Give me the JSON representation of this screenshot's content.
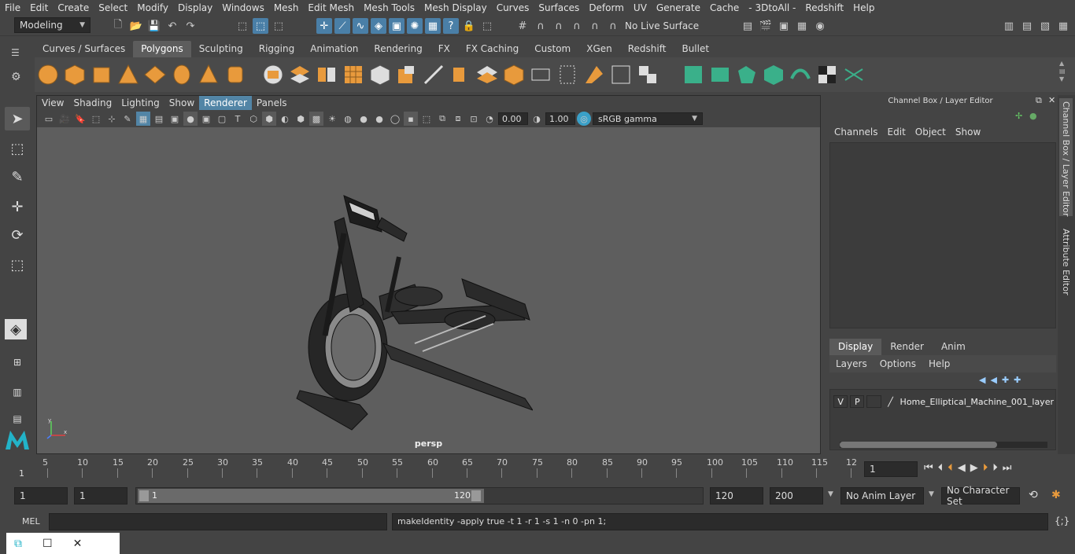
{
  "menubar": [
    "File",
    "Edit",
    "Create",
    "Select",
    "Modify",
    "Display",
    "Windows",
    "Mesh",
    "Edit Mesh",
    "Mesh Tools",
    "Mesh Display",
    "Curves",
    "Surfaces",
    "Deform",
    "UV",
    "Generate",
    "Cache",
    "- 3DtoAll -",
    "Redshift",
    "Help"
  ],
  "status": {
    "mode": "Modeling",
    "live_surface": "No Live Surface"
  },
  "shelf_tabs": [
    "Curves / Surfaces",
    "Polygons",
    "Sculpting",
    "Rigging",
    "Animation",
    "Rendering",
    "FX",
    "FX Caching",
    "Custom",
    "XGen",
    "Redshift",
    "Bullet"
  ],
  "shelf_active": "Polygons",
  "viewport": {
    "menu": [
      "View",
      "Shading",
      "Lighting",
      "Show",
      "Renderer",
      "Panels"
    ],
    "active_menu": "Renderer",
    "exposure": "0.00",
    "gamma": "1.00",
    "color_space": "sRGB gamma",
    "camera_label": "persp"
  },
  "channel_box": {
    "title": "Channel Box / Layer Editor",
    "menu": [
      "Channels",
      "Edit",
      "Object",
      "Show"
    ],
    "layer_tabs": [
      "Display",
      "Render",
      "Anim"
    ],
    "layer_tab_active": "Display",
    "layer_menu": [
      "Layers",
      "Options",
      "Help"
    ],
    "layer": {
      "v": "V",
      "p": "P",
      "name": "Home_Elliptical_Machine_001_layer"
    }
  },
  "side_tabs": {
    "tab1": "Channel Box / Layer Editor",
    "tab2": "Attribute Editor"
  },
  "timeline": {
    "ticks": [
      "5",
      "10",
      "15",
      "20",
      "25",
      "30",
      "35",
      "40",
      "45",
      "50",
      "55",
      "60",
      "65",
      "70",
      "75",
      "80",
      "85",
      "90",
      "95",
      "100",
      "105",
      "110",
      "115",
      "12"
    ],
    "start_marker": "1",
    "current_frame": "1"
  },
  "range": {
    "start": "1",
    "playback_start": "1",
    "slider_start": "1",
    "slider_end": "120",
    "playback_end": "120",
    "end": "200",
    "anim_layer": "No Anim Layer",
    "character_set": "No Character Set"
  },
  "command": {
    "lang": "MEL",
    "history": "makeIdentity -apply true -t 1 -r 1 -s 1 -n 0 -pn 1;"
  }
}
